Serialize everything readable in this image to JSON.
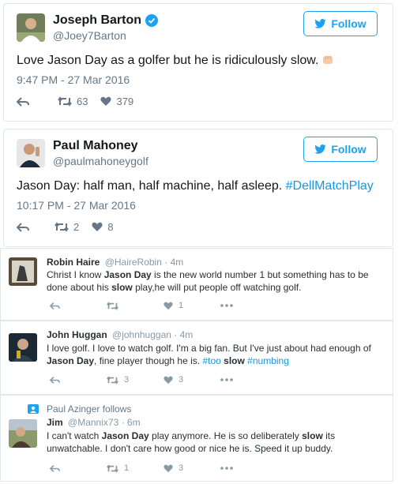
{
  "colors": {
    "accent": "#1da1f2",
    "link": "#1b95e0",
    "muted": "#657786"
  },
  "tweets": [
    {
      "name": "Joseph Barton",
      "handle": "@Joey7Barton",
      "follow_label": "Follow",
      "text": "Love Jason Day as a golfer but he is ridiculously slow.",
      "time": "9:47 PM - 27 Mar 2016",
      "retweets": "63",
      "likes": "379"
    },
    {
      "name": "Paul Mahoney",
      "handle": "@paulmahoneygolf",
      "follow_label": "Follow",
      "text_plain": "Jason Day: half man, half machine, half asleep. ",
      "hashtag": "#DellMatchPlay",
      "time": "10:17 PM - 27 Mar 2016",
      "retweets": "2",
      "likes": "8"
    }
  ],
  "replies": [
    {
      "name": "Robin Haire",
      "handle": "@HaireRobin",
      "age": "· 4m",
      "t1": "Christ I know ",
      "b1": "Jason Day",
      "t2": " is the new world number 1 but something has to be done about his ",
      "b2": "slow",
      "t3": " play,he will put people off watching golf.",
      "retweets": "",
      "likes": "1"
    },
    {
      "name": "John Huggan",
      "handle": "@johnhuggan",
      "age": "· 4m",
      "t1": "I love golf. I love to watch golf. I'm a big fan. But I've just about had enough of ",
      "b1": "Jason Day",
      "t2": ", fine player though he is. ",
      "h1": "#too",
      "b2": "slow",
      "h2": "#numbing",
      "retweets": "3",
      "likes": "3"
    },
    {
      "follows_note": "Paul Azinger follows",
      "name": "Jim",
      "handle": "@Mannix73",
      "age": "· 6m",
      "t1": "I can't watch ",
      "b1": "Jason Day",
      "t2": " play anymore. He is so deliberately ",
      "b2": "slow",
      "t3": " its unwatchable. I don't care how good or nice he is. Speed it up buddy.",
      "retweets": "1",
      "likes": "3"
    }
  ]
}
